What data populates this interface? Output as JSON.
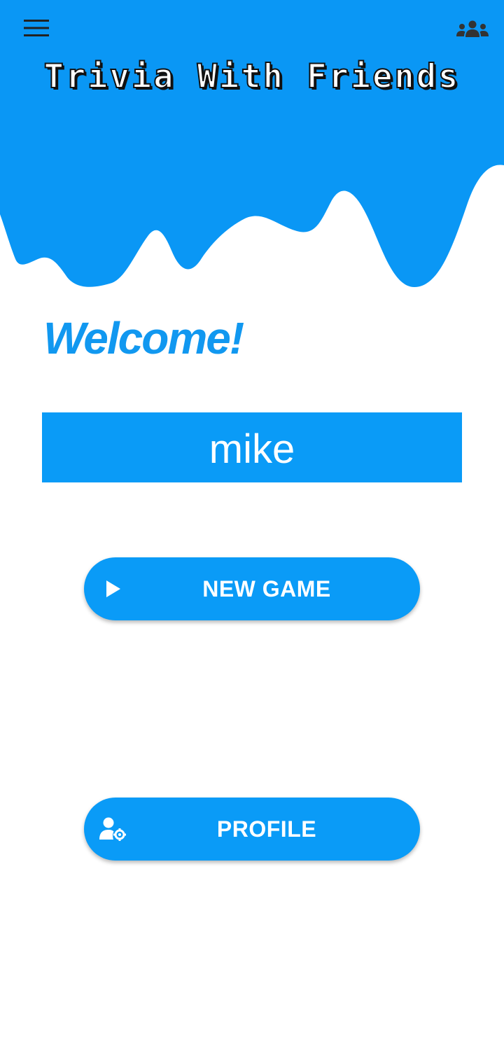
{
  "header": {
    "app_title": "Trivia With Friends",
    "menu_icon": "hamburger-menu-icon",
    "friends_icon": "friends-group-icon",
    "background_color": "#0a97f5"
  },
  "main": {
    "welcome_text": "Welcome!",
    "username": "mike",
    "buttons": {
      "new_game_label": "NEW GAME",
      "new_game_icon": "play-icon",
      "profile_label": "PROFILE",
      "profile_icon": "user-settings-icon"
    },
    "accent_color": "#0a9bf7"
  }
}
